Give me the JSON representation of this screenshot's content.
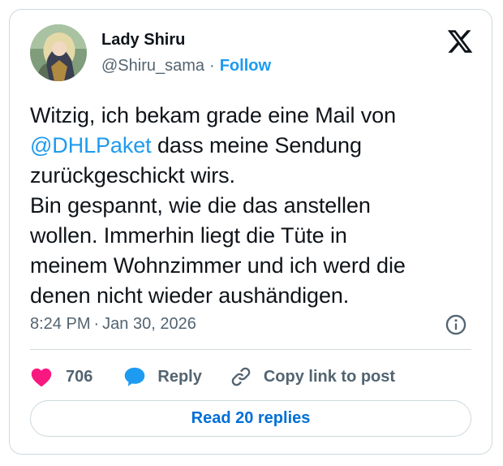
{
  "author": {
    "name": "Lady Shiru",
    "handle": "@Shiru_sama",
    "separator": "·",
    "follow_label": "Follow"
  },
  "tweet": {
    "lines": [
      "Witzig, ich bekam grade eine Mail von",
      "dass meine Sendung",
      "zurückgeschickt wirs.",
      "Bin gespannt, wie die das anstellen",
      "wollen. Immerhin liegt die Tüte in",
      "meinem Wohnzimmer und ich werd die",
      "denen nicht wieder aushändigen."
    ],
    "mention": "@DHLPaket"
  },
  "meta": {
    "time": "8:24 PM",
    "separator": "·",
    "date": "Jan 30, 2026"
  },
  "actions": {
    "like_count": "706",
    "reply_label": "Reply",
    "copy_label": "Copy link to post"
  },
  "read_replies_label": "Read 20 replies",
  "icons": {
    "logo": "x-logo-icon",
    "info": "info-icon",
    "like": "heart-icon",
    "reply": "speech-bubble-icon",
    "copy": "link-icon"
  },
  "colors": {
    "accent": "#1d9bf0",
    "heart": "#f91880",
    "read_replies": "#006fd6",
    "secondary_text": "#536471",
    "border": "#cfd9de"
  }
}
